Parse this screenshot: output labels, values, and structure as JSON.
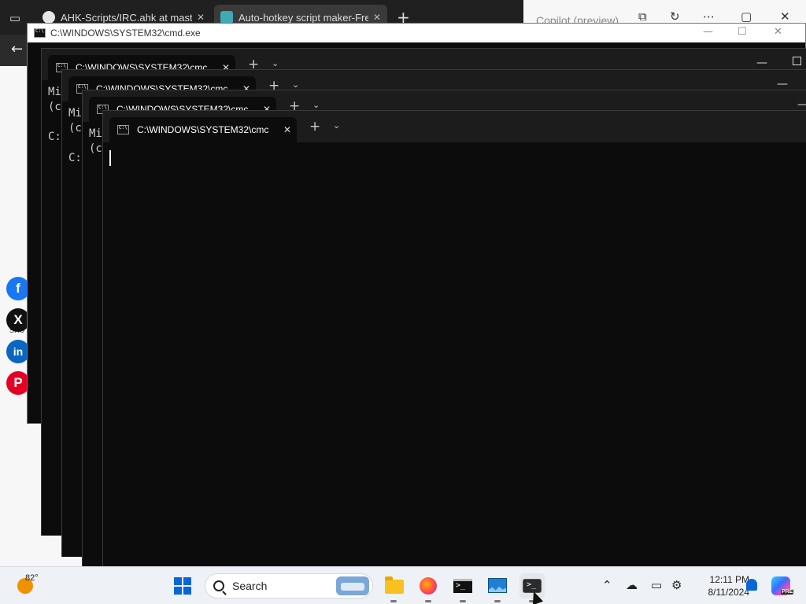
{
  "browser": {
    "tabs": [
      {
        "label": "AHK-Scripts/IRC.ahk at master"
      },
      {
        "label": "Auto-hotkey script maker-Fre"
      }
    ],
    "new_tab": "+",
    "copilot": {
      "title": "Copilot (preview)"
    },
    "share_label": "sho"
  },
  "social": [
    {
      "name": "facebook-icon",
      "glyph": "f",
      "color": "#1877f2"
    },
    {
      "name": "x-icon",
      "glyph": "X",
      "color": "#111111"
    },
    {
      "name": "linkedin-icon",
      "glyph": "in",
      "color": "#0a66c2"
    },
    {
      "name": "pinterest-icon",
      "glyph": "P",
      "color": "#e60023"
    }
  ],
  "cmd_window": {
    "title": "C:\\WINDOWS\\SYSTEM32\\cmd.exe"
  },
  "terminals": [
    {
      "tab_label": "C:\\WINDOWS\\SYSTEM32\\cmc",
      "lines": "Mi\n(c\n\nC:"
    },
    {
      "tab_label": "C:\\WINDOWS\\SYSTEM32\\cmc",
      "lines": "Mi\n(c\n\nC:"
    },
    {
      "tab_label": "C:\\WINDOWS\\SYSTEM32\\cmc",
      "lines": "Mi\n(c"
    },
    {
      "tab_label": "C:\\WINDOWS\\SYSTEM32\\cmc",
      "lines": ""
    }
  ],
  "taskbar": {
    "temperature": "82°",
    "search_label": "Search",
    "time": "12:11 PM",
    "date": "8/11/2024",
    "badge": "PRE"
  }
}
